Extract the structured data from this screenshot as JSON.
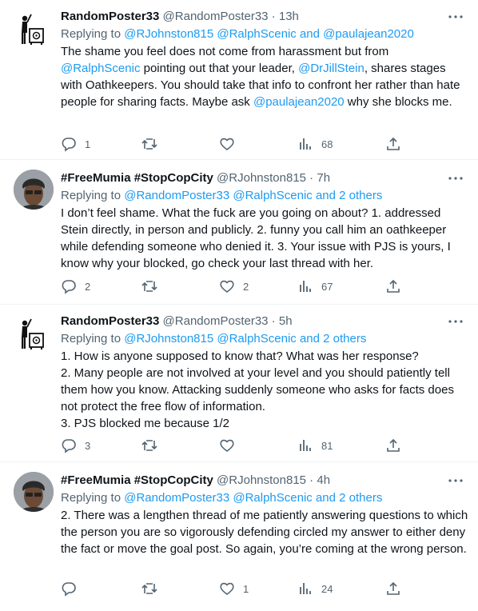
{
  "tweets": [
    {
      "name": "RandomPoster33",
      "handle": "@RandomPoster33",
      "dot": " · ",
      "time": "13h",
      "replying": {
        "prefix": "Replying to ",
        "links": "@RJohnston815 @RalphScenic and @paulajean2020"
      },
      "body": [
        {
          "t": "The shame you feel does not come from harassment but from "
        },
        {
          "t": "@RalphScenic",
          "link": true
        },
        {
          "t": " pointing out that your leader, "
        },
        {
          "t": "@DrJillStein",
          "link": true
        },
        {
          "t": ", shares stages with Oathkeepers. You should take that info to confront her rather than hate people for sharing facts. Maybe ask "
        },
        {
          "t": "@paulajean2020",
          "link": true
        },
        {
          "t": " why she blocks me."
        }
      ],
      "counts": {
        "reply": "1",
        "retweet": "",
        "like": "",
        "views": "68"
      },
      "avatar": "random-logo"
    },
    {
      "name": "#FreeMumia #StopCopCity",
      "handle": "@RJohnston815",
      "dot": " · ",
      "time": "7h",
      "replying": {
        "prefix": "Replying to ",
        "links": "@RandomPoster33 @RalphScenic and 2 others"
      },
      "body": [
        {
          "t": "I don’t feel shame. What the fuck are you going on about? 1. addressed Stein directly, in person and publicly. 2. funny you call him an oathkeeper while defending someone who denied it. 3. Your issue with PJS is yours, I know why your blocked, go check your last thread with her."
        }
      ],
      "counts": {
        "reply": "2",
        "retweet": "",
        "like": "2",
        "views": "67"
      },
      "avatar": "person-photo"
    },
    {
      "name": "RandomPoster33",
      "handle": "@RandomPoster33",
      "dot": " · ",
      "time": "5h",
      "replying": {
        "prefix": "Replying to ",
        "links": "@RJohnston815 @RalphScenic and 2 others"
      },
      "body": [
        {
          "t": "1. How is anyone supposed to know that? What was her response?\n2. Many people are not involved at your level and you should patiently tell them how you know. Attacking suddenly someone who asks for facts does not protect the free flow of information.\n3. PJS blocked me because 1/2"
        }
      ],
      "counts": {
        "reply": "3",
        "retweet": "",
        "like": "",
        "views": "81"
      },
      "avatar": "random-logo"
    },
    {
      "name": "#FreeMumia #StopCopCity",
      "handle": "@RJohnston815",
      "dot": " · ",
      "time": "4h",
      "replying": {
        "prefix": "Replying to ",
        "links": "@RandomPoster33 @RalphScenic and 2 others"
      },
      "body": [
        {
          "t": "2. There was a lengthen thread of me patiently answering questions to which the person you are so vigorously defending circled my answer to either deny the fact or move the goal post. So again, you’re coming at the wrong person."
        }
      ],
      "counts": {
        "reply": "",
        "retweet": "",
        "like": "1",
        "views": "24"
      },
      "avatar": "person-photo"
    }
  ],
  "colors": {
    "link": "#1d9bf0",
    "muted": "#536471",
    "text": "#0f1419",
    "divider": "#eff3f4"
  },
  "icons": [
    "more-icon",
    "reply-icon",
    "retweet-icon",
    "like-icon",
    "views-icon",
    "share-icon"
  ]
}
